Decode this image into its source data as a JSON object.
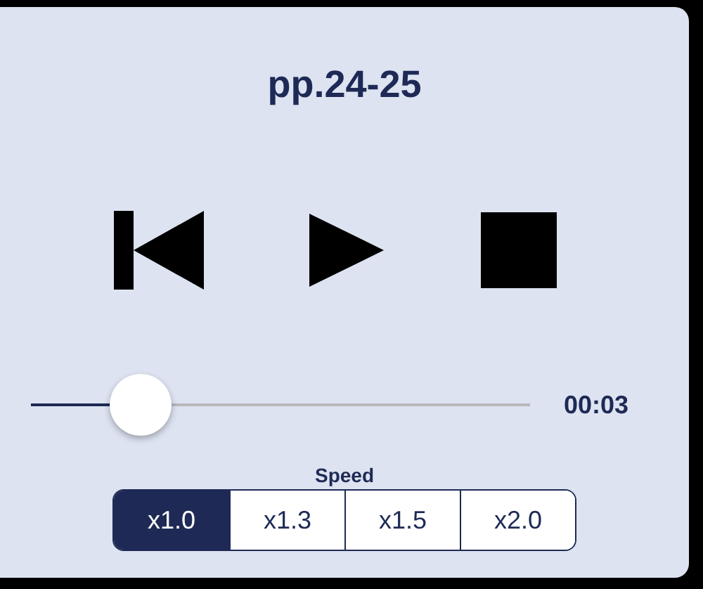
{
  "title": "pp.24-25",
  "controls": [
    {
      "kind": "previous"
    },
    {
      "kind": "play"
    },
    {
      "kind": "stop"
    }
  ],
  "progress": {
    "level": 0.22,
    "time": "00:03"
  },
  "speed": {
    "label": "Speed",
    "options": [
      {
        "label": "x1.0",
        "selected": true
      },
      {
        "label": "x1.3",
        "selected": false
      },
      {
        "label": "x1.5",
        "selected": false
      },
      {
        "label": "x2.0",
        "selected": false
      }
    ]
  }
}
